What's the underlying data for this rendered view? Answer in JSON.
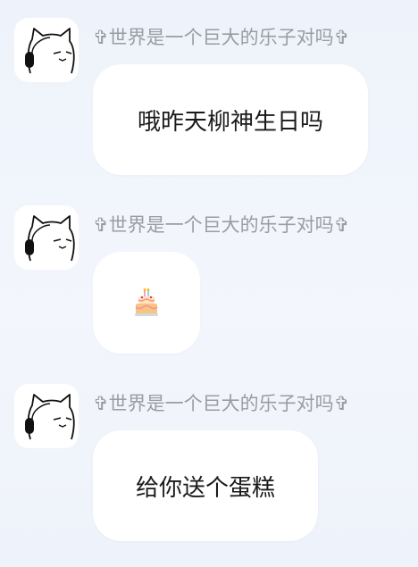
{
  "messages": [
    {
      "sender": "✞世界是一个巨大的乐子对吗✞",
      "text": "哦昨天柳神生日吗",
      "avatar_icon": "cat-with-headphones-icon"
    },
    {
      "sender": "✞世界是一个巨大的乐子对吗✞",
      "text": "",
      "emoji": "birthday-cake-icon",
      "avatar_icon": "cat-with-headphones-icon"
    },
    {
      "sender": "✞世界是一个巨大的乐子对吗✞",
      "text": "给你送个蛋糕",
      "avatar_icon": "cat-with-headphones-icon"
    }
  ]
}
